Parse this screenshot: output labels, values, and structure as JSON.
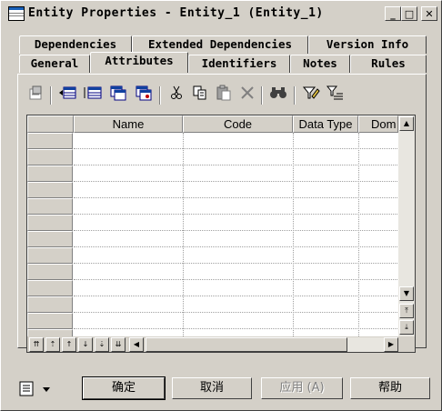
{
  "window": {
    "title": "Entity Properties - Entity_1 (Entity_1)"
  },
  "title_buttons": {
    "minimize": "_",
    "maximize": "□",
    "close": "✕"
  },
  "tabs_back": [
    "Dependencies",
    "Extended Dependencies",
    "Version Info"
  ],
  "tabs_front": [
    "General",
    "Attributes",
    "Identifiers",
    "Notes",
    "Rules"
  ],
  "active_tab": "Attributes",
  "toolbar_icons": [
    "properties-icon",
    "insert-row-icon",
    "add-row-icon",
    "add-columns-icon",
    "reuse-columns-icon",
    "cut-icon",
    "copy-icon",
    "paste-icon",
    "delete-icon",
    "find-icon",
    "filter-icon",
    "customize-columns-icon"
  ],
  "grid": {
    "columns": [
      "Name",
      "Code",
      "Data Type",
      "Dom"
    ],
    "row_count": 13
  },
  "buttons": {
    "ok": "确定",
    "cancel": "取消",
    "apply": "应用 (A)",
    "help": "帮助"
  }
}
